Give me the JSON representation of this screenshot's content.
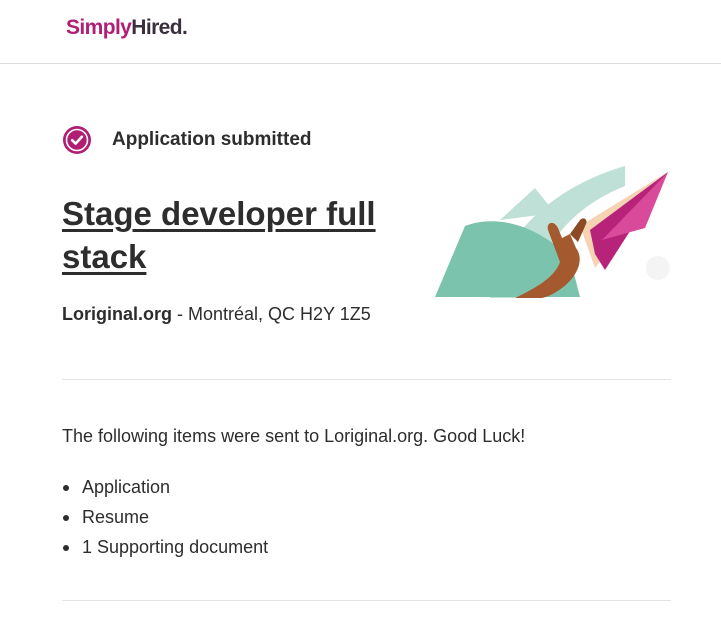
{
  "header": {
    "logo_part1": "Simply",
    "logo_part2": "Hired",
    "logo_dot": "."
  },
  "status": {
    "icon": "check-circle-icon",
    "text": "Application submitted"
  },
  "job": {
    "title": "Stage developer full stack",
    "company": "Loriginal.org",
    "separator": " - ",
    "location": "Montréal, QC H2Y 1Z5"
  },
  "sent": {
    "message": "The following items were sent to Loriginal.org. Good Luck!",
    "items": [
      "Application",
      "Resume",
      "1 Supporting document"
    ]
  },
  "colors": {
    "brand_magenta": "#b01f74",
    "brand_dark": "#3a2f3f",
    "teal": "#7cc3ae",
    "text": "#2d2d2d"
  }
}
